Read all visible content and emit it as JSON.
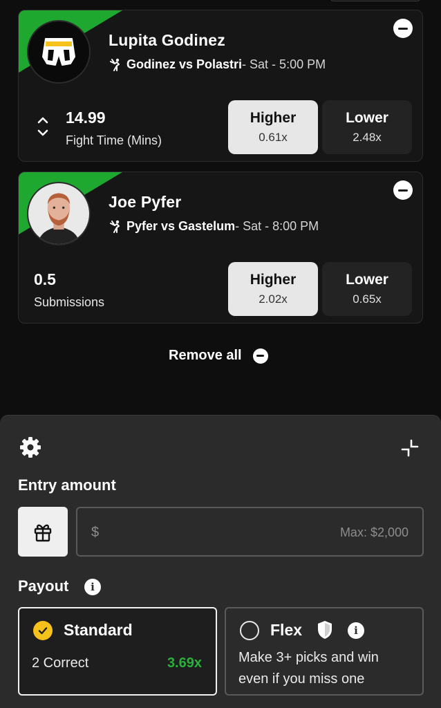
{
  "picks": [
    {
      "player_name": "Lupita Godinez",
      "matchup": "Godinez vs Polastri",
      "schedule": " - Sat - 5:00 PM",
      "stat_value": "14.99",
      "stat_label": "Fight Time (Mins)",
      "higher_label": "Higher",
      "higher_multiplier": "0.61x",
      "lower_label": "Lower",
      "lower_multiplier": "2.48x",
      "selected": "higher",
      "avatar_icon": "fight-shorts-icon"
    },
    {
      "player_name": "Joe Pyfer",
      "matchup": "Pyfer vs Gastelum",
      "schedule": " - Sat - 8:00 PM",
      "stat_value": "0.5",
      "stat_label": "Submissions",
      "higher_label": "Higher",
      "higher_multiplier": "2.02x",
      "lower_label": "Lower",
      "lower_multiplier": "0.65x",
      "selected": "higher",
      "avatar_icon": "player-headshot"
    }
  ],
  "remove_all_label": "Remove all",
  "entry": {
    "label": "Entry amount",
    "currency_symbol": "$",
    "max_hint": "Max: $2,000"
  },
  "payout": {
    "label": "Payout",
    "standard": {
      "title": "Standard",
      "correct": "2 Correct",
      "multiplier": "3.69x",
      "selected": true
    },
    "flex": {
      "title": "Flex",
      "description": "Make 3+ picks and win even if you miss one",
      "selected": false
    }
  },
  "colors": {
    "accent_green": "#1ea82f",
    "multiplier_green": "#27b23a",
    "check_yellow": "#f5c21b",
    "background": "#0e0e0e",
    "sheet": "#2b2b2b"
  }
}
